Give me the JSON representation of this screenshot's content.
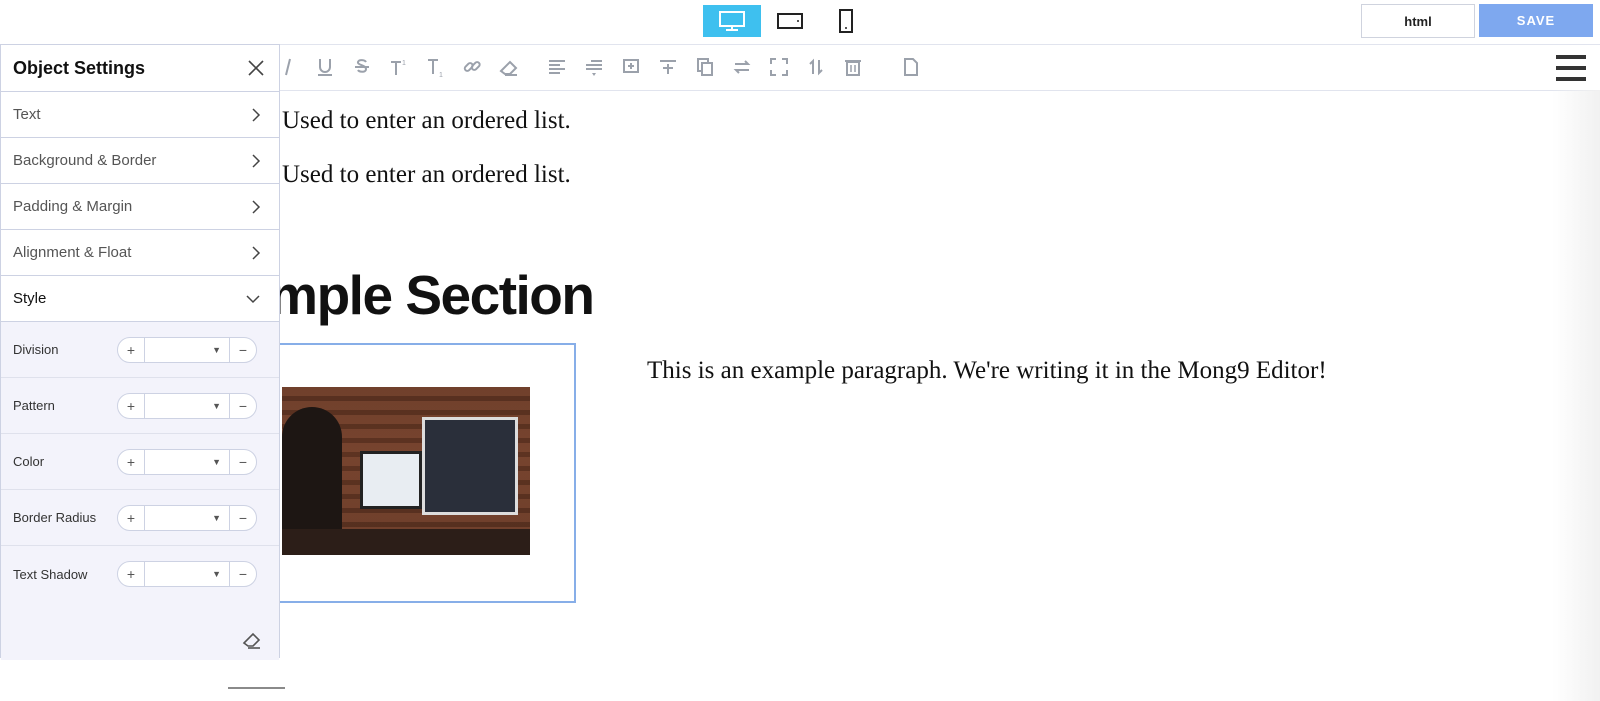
{
  "topbar": {
    "devices": [
      {
        "name": "desktop",
        "icon": "desktop-icon",
        "active": true
      },
      {
        "name": "tablet",
        "icon": "tablet-icon",
        "active": false
      },
      {
        "name": "mobile",
        "icon": "mobile-icon",
        "active": false
      }
    ],
    "html_label": "html",
    "save_label": "SAVE",
    "accent_color": "#3ec0ef",
    "save_color": "#7ea8ef"
  },
  "toolbar": {
    "icons": [
      "italic-icon",
      "underline-icon",
      "strikethrough-icon",
      "superscript-icon",
      "subscript-icon",
      "link-icon",
      "eraser-icon",
      "align-left-icon",
      "indent-icon",
      "insert-below-icon",
      "insert-above-icon",
      "copy-icon",
      "swap-icon",
      "fullscreen-icon",
      "move-icon",
      "trash-icon",
      "document-icon",
      "menu-icon"
    ]
  },
  "panel": {
    "title": "Object Settings",
    "sections": [
      {
        "label": "Text",
        "open": false
      },
      {
        "label": "Background & Border",
        "open": false
      },
      {
        "label": "Padding & Margin",
        "open": false
      },
      {
        "label": "Alignment & Float",
        "open": false
      },
      {
        "label": "Style",
        "open": true
      }
    ],
    "style_props": [
      {
        "label": "Division",
        "value": ""
      },
      {
        "label": "Pattern",
        "value": ""
      },
      {
        "label": "Color",
        "value": ""
      },
      {
        "label": "Border Radius",
        "value": ""
      },
      {
        "label": "Text Shadow",
        "value": ""
      }
    ],
    "plus": "+",
    "minus": "−",
    "dropdown_arrow": "▼"
  },
  "content": {
    "list_items": [
      "Used to enter an ordered list.",
      "Used to enter an ordered list."
    ],
    "heading": "xample Section",
    "paragraph": "This is an example paragraph. We're writing it in the Mong9 Editor!"
  }
}
